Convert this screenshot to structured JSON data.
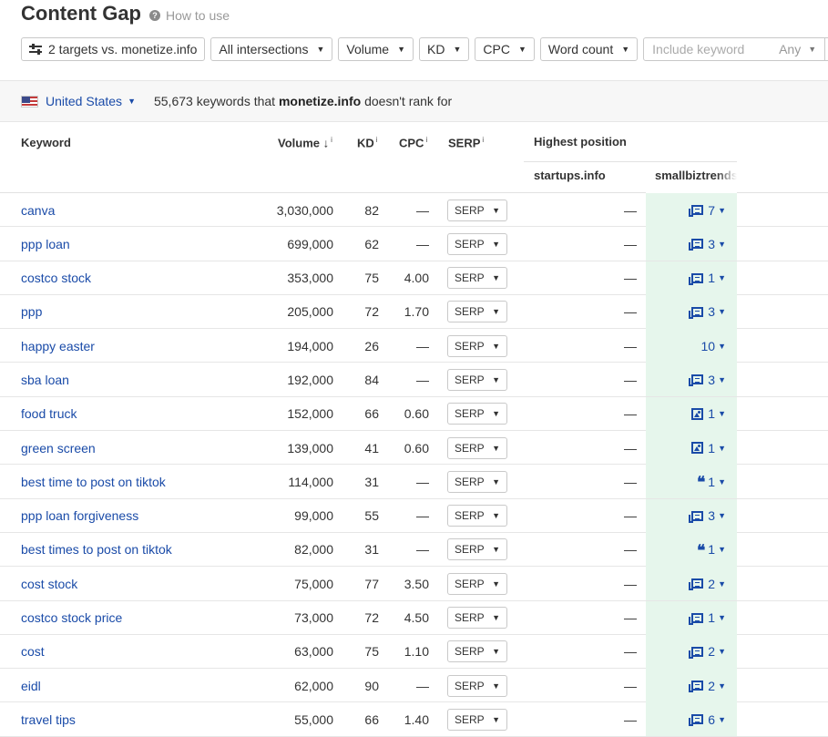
{
  "header": {
    "title": "Content Gap",
    "help_label": "How to use",
    "help_icon": "question-circle-icon"
  },
  "filters": {
    "targets_label": "2 targets vs. monetize.info",
    "intersections": "All intersections",
    "volume": "Volume",
    "kd": "KD",
    "cpc": "CPC",
    "word_count": "Word count",
    "keyword_placeholder": "Include keyword",
    "keyword_scope": "Any"
  },
  "bar": {
    "country": "United States",
    "count": "55,673",
    "summary_mid": "keywords that",
    "domain": "monetize.info",
    "summary_end": "doesn't rank for"
  },
  "table": {
    "headers": {
      "keyword": "Keyword",
      "volume": "Volume",
      "sort_indicator": "↓",
      "kd": "KD",
      "cpc": "CPC",
      "serp": "SERP",
      "info": "i",
      "highest_position": "Highest position",
      "col_startups": "startups.info",
      "col_smallbiz": "smallbiztrends"
    },
    "serp_label": "SERP",
    "rows": [
      {
        "keyword": "canva",
        "volume": "3,030,000",
        "kd": "82",
        "cpc": "—",
        "startups": "—",
        "pos": "7",
        "icon": "doc"
      },
      {
        "keyword": "ppp loan",
        "volume": "699,000",
        "kd": "62",
        "cpc": "—",
        "startups": "—",
        "pos": "3",
        "icon": "doc"
      },
      {
        "keyword": "costco stock",
        "volume": "353,000",
        "kd": "75",
        "cpc": "4.00",
        "startups": "—",
        "pos": "1",
        "icon": "doc"
      },
      {
        "keyword": "ppp",
        "volume": "205,000",
        "kd": "72",
        "cpc": "1.70",
        "startups": "—",
        "pos": "3",
        "icon": "doc"
      },
      {
        "keyword": "happy easter",
        "volume": "194,000",
        "kd": "26",
        "cpc": "—",
        "startups": "—",
        "pos": "10",
        "icon": "none"
      },
      {
        "keyword": "sba loan",
        "volume": "192,000",
        "kd": "84",
        "cpc": "—",
        "startups": "—",
        "pos": "3",
        "icon": "doc"
      },
      {
        "keyword": "food truck",
        "volume": "152,000",
        "kd": "66",
        "cpc": "0.60",
        "startups": "—",
        "pos": "1",
        "icon": "image"
      },
      {
        "keyword": "green screen",
        "volume": "139,000",
        "kd": "41",
        "cpc": "0.60",
        "startups": "—",
        "pos": "1",
        "icon": "image"
      },
      {
        "keyword": "best time to post on tiktok",
        "volume": "114,000",
        "kd": "31",
        "cpc": "—",
        "startups": "—",
        "pos": "1",
        "icon": "quote"
      },
      {
        "keyword": "ppp loan forgiveness",
        "volume": "99,000",
        "kd": "55",
        "cpc": "—",
        "startups": "—",
        "pos": "3",
        "icon": "doc"
      },
      {
        "keyword": "best times to post on tiktok",
        "volume": "82,000",
        "kd": "31",
        "cpc": "—",
        "startups": "—",
        "pos": "1",
        "icon": "quote"
      },
      {
        "keyword": "cost stock",
        "volume": "75,000",
        "kd": "77",
        "cpc": "3.50",
        "startups": "—",
        "pos": "2",
        "icon": "doc"
      },
      {
        "keyword": "costco stock price",
        "volume": "73,000",
        "kd": "72",
        "cpc": "4.50",
        "startups": "—",
        "pos": "1",
        "icon": "doc"
      },
      {
        "keyword": "cost",
        "volume": "63,000",
        "kd": "75",
        "cpc": "1.10",
        "startups": "—",
        "pos": "2",
        "icon": "doc"
      },
      {
        "keyword": "eidl",
        "volume": "62,000",
        "kd": "90",
        "cpc": "—",
        "startups": "—",
        "pos": "2",
        "icon": "doc"
      },
      {
        "keyword": "travel tips",
        "volume": "55,000",
        "kd": "66",
        "cpc": "1.40",
        "startups": "—",
        "pos": "6",
        "icon": "doc"
      }
    ]
  },
  "colors": {
    "link": "#1a4ba8",
    "highlight_column": "#e6f6ec",
    "bar_bg": "#f7f7f7"
  }
}
